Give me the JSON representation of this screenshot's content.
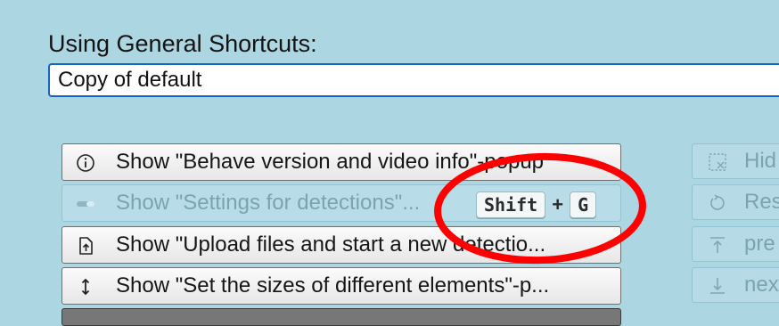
{
  "heading": "Using General Shortcuts:",
  "shortcut_profile": {
    "value": "Copy of default"
  },
  "buttons": [
    {
      "label": "Show \"Behave version and video info\"-popup",
      "icon": "info-icon",
      "disabled": false
    },
    {
      "label": "Show \"Settings for detections\"...",
      "icon": "toggle-icon",
      "disabled": true
    },
    {
      "label": "Show \"Upload files and start a new detectio...",
      "icon": "upload-file-icon",
      "disabled": false
    },
    {
      "label": "Show \"Set the sizes of different elements\"-p...",
      "icon": "resize-vertical-icon",
      "disabled": false
    }
  ],
  "shortcut_keys": {
    "modifier": "Shift",
    "plus": "+",
    "key": "G"
  },
  "side_buttons": [
    {
      "label": "Hid",
      "icon": "hide-selection-icon"
    },
    {
      "label": "Res",
      "icon": "reset-icon"
    },
    {
      "label": "pre",
      "icon": "previous-icon"
    },
    {
      "label": "nex",
      "icon": "next-icon"
    }
  ],
  "annotation": {
    "color": "#ff0000"
  }
}
